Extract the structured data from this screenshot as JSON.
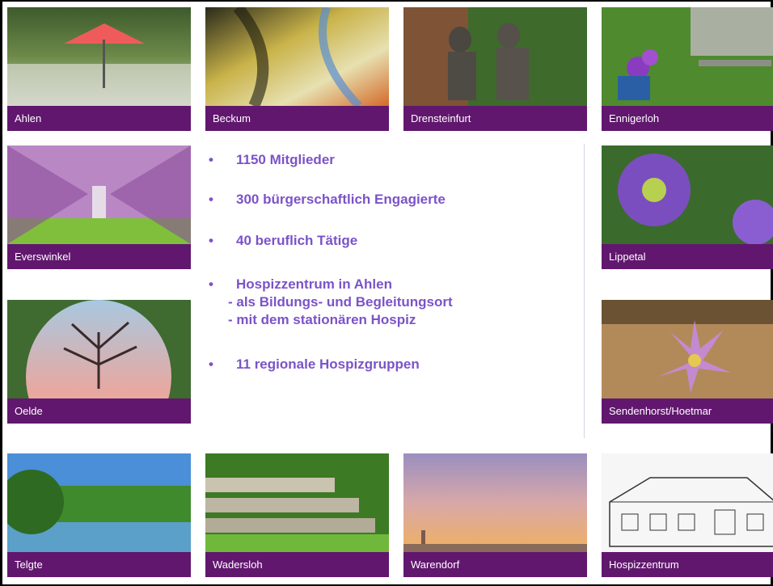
{
  "tiles": [
    {
      "name": "tile-ahlen",
      "label": "Ahlen"
    },
    {
      "name": "tile-beckum",
      "label": "Beckum"
    },
    {
      "name": "tile-drensteinfurt",
      "label": "Drensteinfurt"
    },
    {
      "name": "tile-ennigerloh",
      "label": "Ennigerloh"
    },
    {
      "name": "tile-everswinkel",
      "label": "Everswinkel"
    },
    {
      "name": "tile-lippetal",
      "label": "Lippetal"
    },
    {
      "name": "tile-oelde",
      "label": "Oelde"
    },
    {
      "name": "tile-sendenhorst",
      "label": "Sendenhorst/Hoetmar"
    },
    {
      "name": "tile-telgte",
      "label": "Telgte"
    },
    {
      "name": "tile-wadersloh",
      "label": "Wadersloh"
    },
    {
      "name": "tile-warendorf",
      "label": "Warendorf"
    },
    {
      "name": "tile-hospizzentrum",
      "label": "Hospizzentrum"
    }
  ],
  "bullets": {
    "marker": "•",
    "members": "1150 Mitglieder",
    "volunteers": "300 bürgerschaftlich Engagierte",
    "professionals": "40 beruflich Tätige",
    "center": "Hospizzentrum in Ahlen",
    "center_sub1": "- als Bildungs- und Begleitungsort",
    "center_sub2": "- mit dem stationären Hospiz",
    "groups": "11 regionale Hospizgruppen"
  }
}
